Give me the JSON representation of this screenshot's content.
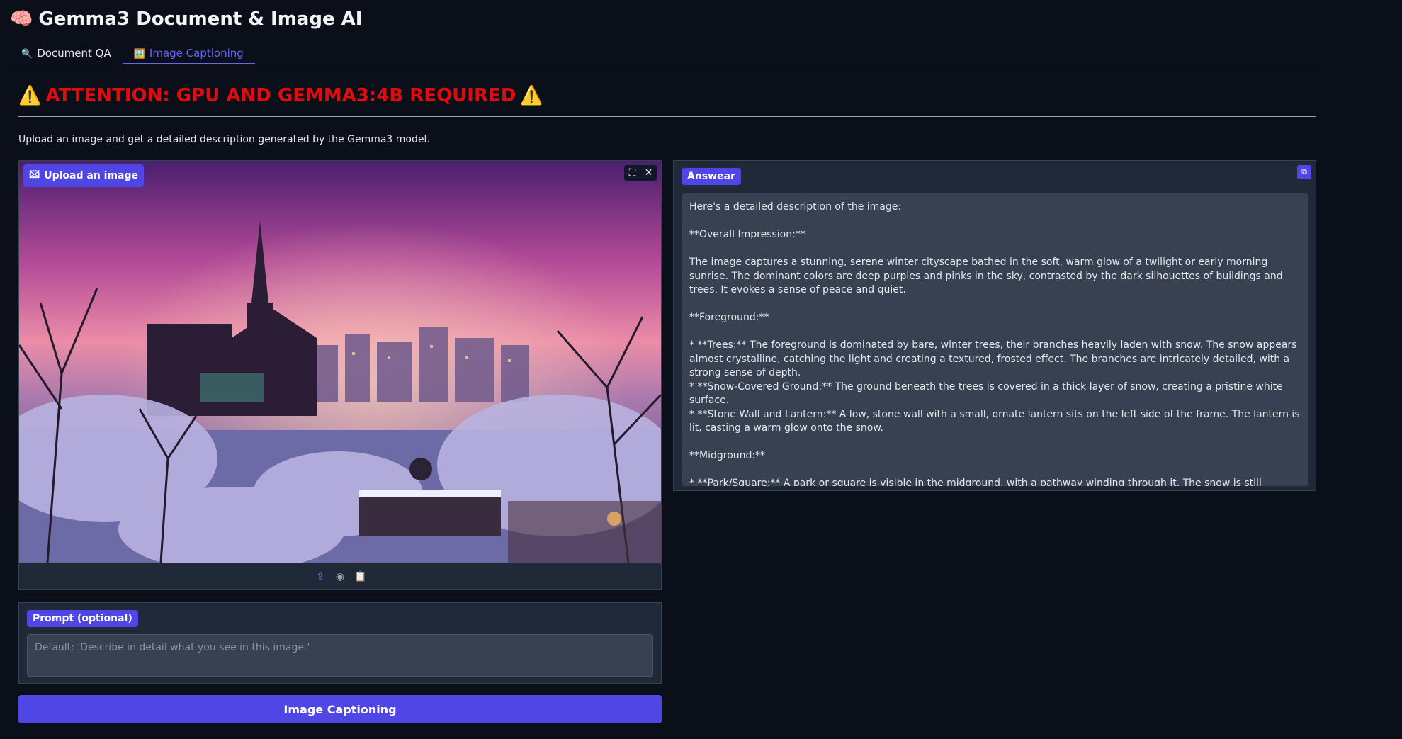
{
  "app": {
    "icon": "🧠",
    "title": "Gemma3 Document & Image AI"
  },
  "tabs": [
    {
      "icon": "🔍",
      "label": "Document QA",
      "active": false
    },
    {
      "icon": "🖼️",
      "label": "Image Captioning",
      "active": true
    }
  ],
  "warning": {
    "icon": "⚠️",
    "text": "ATTENTION: GPU AND GEMMA3:4B REQUIRED"
  },
  "intro": "Upload an image and get a detailed description generated by the Gemma3 model.",
  "image_input": {
    "label": "Upload an image",
    "controls": {
      "fullscreen": "⛶",
      "close": "✕"
    },
    "toolbar": {
      "upload": "⇪",
      "webcam": "◉",
      "clipboard": "📋"
    }
  },
  "answer": {
    "label": "Answear",
    "copy_icon": "⧉",
    "lines": [
      "Here's a detailed description of the image:",
      "",
      "**Overall Impression:**",
      "",
      "The image captures a stunning, serene winter cityscape bathed in the soft, warm glow of a twilight or early morning sunrise. The dominant colors are deep purples and pinks in the sky, contrasted by the dark silhouettes of buildings and trees. It evokes a sense of peace and quiet.",
      "",
      "**Foreground:**",
      "",
      "*   **Trees:** The foreground is dominated by bare, winter trees, their branches heavily laden with snow. The snow appears almost crystalline, catching the light and creating a textured, frosted effect. The branches are intricately detailed, with a strong sense of depth.",
      "*   **Snow-Covered Ground:** The ground beneath the trees is covered in a thick layer of snow, creating a pristine white surface.",
      "*   **Stone Wall and Lantern:** A low, stone wall with a small, ornate lantern sits on the left side of the frame. The lantern is lit, casting a warm glow onto the snow.",
      "",
      "**Midground:**",
      "",
      "*   **Park/Square:** A park or square is visible in the midground, with a pathway winding through it. The snow is still"
    ]
  },
  "prompt": {
    "label": "Prompt (optional)",
    "value": "",
    "placeholder": "Default: 'Describe in detail what you see in this image.'"
  },
  "run_button": "Image Captioning"
}
